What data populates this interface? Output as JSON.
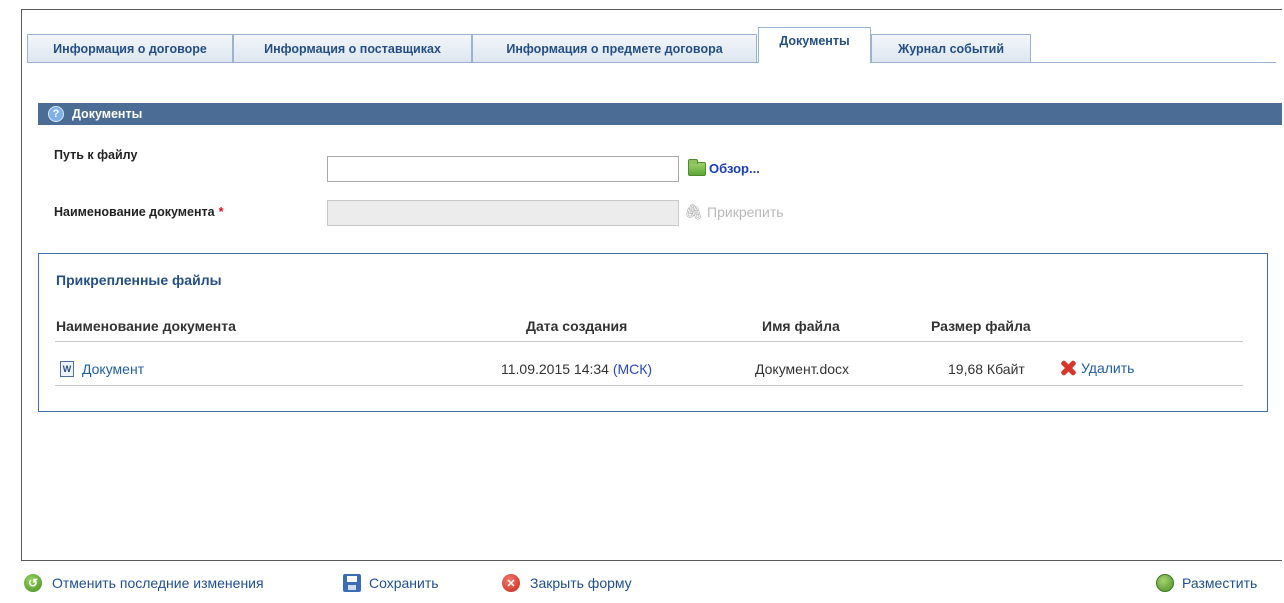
{
  "tabs": [
    {
      "label": "Информация о договоре"
    },
    {
      "label": "Информация о поставщиках"
    },
    {
      "label": "Информация о предмете договора"
    },
    {
      "label": "Документы"
    },
    {
      "label": "Журнал событий"
    }
  ],
  "active_tab": "Документы",
  "section": {
    "help_icon": "?",
    "title": "Документы"
  },
  "form": {
    "file_path_label": "Путь к файлу",
    "file_path_value": "",
    "browse_label": "Обзор...",
    "doc_name_label": "Наименование документа",
    "required_mark": "*",
    "doc_name_value": "",
    "attach_label": "Прикрепить"
  },
  "attached": {
    "title": "Прикрепленные файлы",
    "columns": {
      "name": "Наименование документа",
      "date": "Дата создания",
      "filename": "Имя файла",
      "size": "Размер файла"
    },
    "rows": [
      {
        "name": "Документ",
        "date": "11.09.2015 14:34",
        "tz": "(МСК)",
        "filename": "Документ.docx",
        "size": "19,68 Кбайт",
        "delete_label": "Удалить"
      }
    ]
  },
  "footer": {
    "undo_label": "Отменить последние изменения",
    "save_label": "Сохранить",
    "close_label": "Закрыть форму",
    "publish_label": "Разместить"
  },
  "icons": {
    "help": "help-icon",
    "browse": "folder-icon",
    "attach": "paperclip-icon",
    "doc": "word-document-icon",
    "delete": "delete-x-icon",
    "undo": "undo-icon",
    "save": "floppy-disk-icon",
    "close": "close-circle-icon",
    "publish": "globe-icon"
  },
  "colors": {
    "header_bg": "#4b6c94",
    "tab_text": "#244f86",
    "link": "#1f5ea8",
    "required": "#dd1111"
  }
}
